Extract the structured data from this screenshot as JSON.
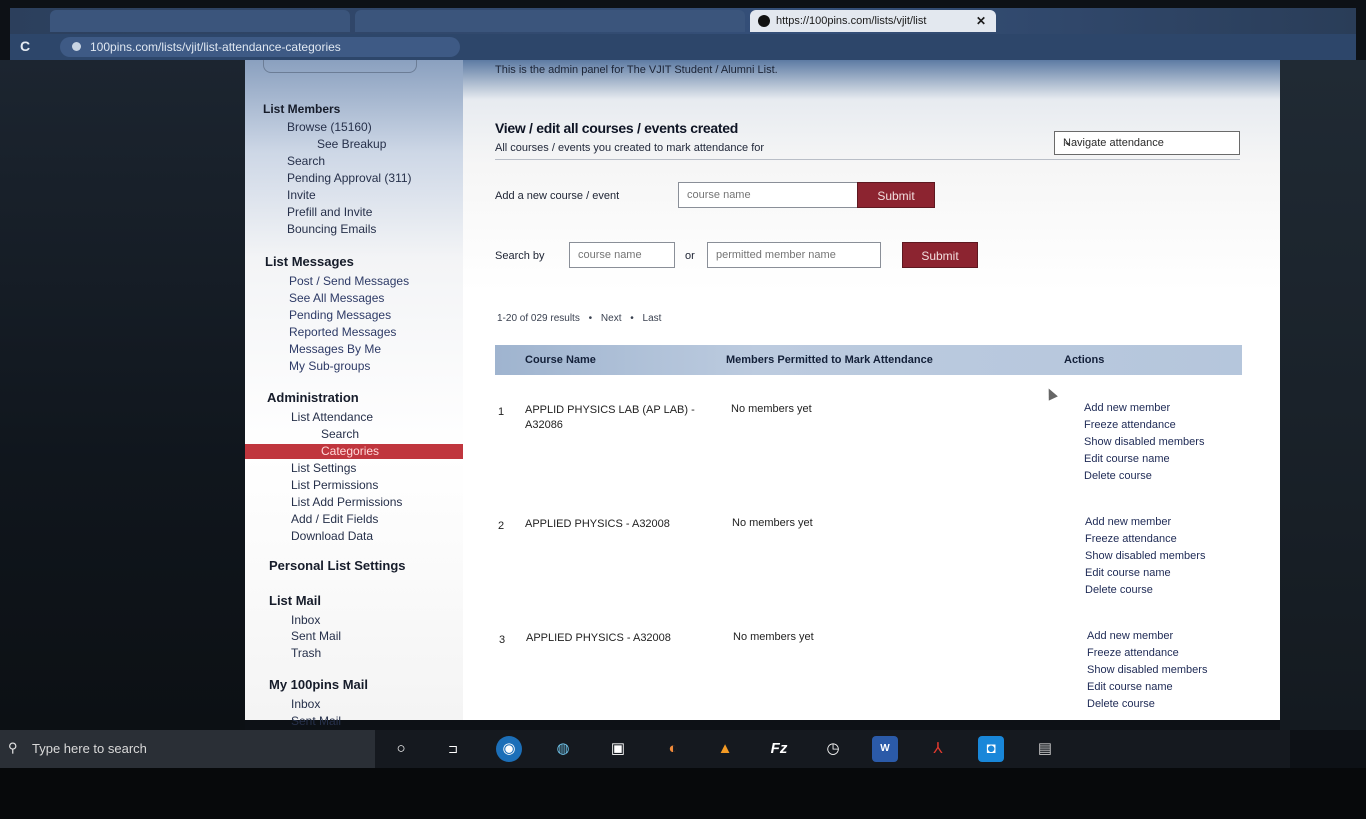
{
  "browser": {
    "active_tab_title": "https://100pins.com/lists/vjit/list",
    "url": "100pins.com/lists/vjit/list-attendance-categories"
  },
  "sidebar": {
    "sections": [
      {
        "title": "List Members",
        "items": [
          "Browse (15160)",
          "See Breakup",
          "Search",
          "Pending Approval (311)",
          "Invite",
          "Prefill and Invite",
          "Bouncing Emails"
        ]
      },
      {
        "title": "List Messages",
        "items": [
          "Post / Send Messages",
          "See All Messages",
          "Pending Messages",
          "Reported Messages",
          "Messages By Me",
          "My Sub-groups"
        ]
      },
      {
        "title": "Administration",
        "items": [
          "List Attendance",
          "Search",
          "Categories",
          "List Settings",
          "List Permissions",
          "List Add Permissions",
          "Add / Edit Fields",
          "Download Data"
        ]
      },
      {
        "title": "Personal List Settings",
        "items": []
      },
      {
        "title": "List Mail",
        "items": [
          "Inbox",
          "Sent Mail",
          "Trash"
        ]
      },
      {
        "title": "My 100pins Mail",
        "items": [
          "Inbox",
          "Sent Mail"
        ]
      }
    ],
    "active_item": "Categories"
  },
  "main": {
    "notice": "This is the admin panel for The VJIT Student / Alumni List.",
    "title": "View / edit all courses / events created",
    "subtitle": "All courses / events you created to mark attendance for",
    "navigate_select": "Navigate attendance",
    "add_label": "Add a new course / event",
    "add_placeholder": "course name",
    "submit_label": "Submit",
    "search_label": "Search by",
    "search_course_placeholder": "course name",
    "or_label": "or",
    "search_member_placeholder": "permitted member name",
    "pager": {
      "summary": "1-20 of 029 results",
      "bullet": "•",
      "next": "Next",
      "last": "Last"
    },
    "columns": {
      "name": "Course Name",
      "members": "Members Permitted to Mark Attendance",
      "actions": "Actions"
    },
    "rows": [
      {
        "num": "1",
        "name": "APPLID PHYSICS LAB (AP LAB) - A32086",
        "members": "No members yet"
      },
      {
        "num": "2",
        "name": "APPLIED PHYSICS - A32008",
        "members": "No members yet"
      },
      {
        "num": "3",
        "name": "APPLIED PHYSICS - A32008",
        "members": "No members yet"
      }
    ],
    "actions": [
      "Add new member",
      "Freeze attendance",
      "Show disabled members",
      "Edit course name",
      "Delete course"
    ]
  },
  "taskbar": {
    "search_placeholder": "Type here to search",
    "icons": [
      "cortana-icon",
      "task-view-icon",
      "chrome-icon",
      "globe-icon",
      "store-icon",
      "firefox-icon",
      "vlc-icon",
      "filezilla-icon",
      "clock-icon",
      "word-icon",
      "pdf-icon",
      "camera-icon",
      "app-icon"
    ]
  }
}
